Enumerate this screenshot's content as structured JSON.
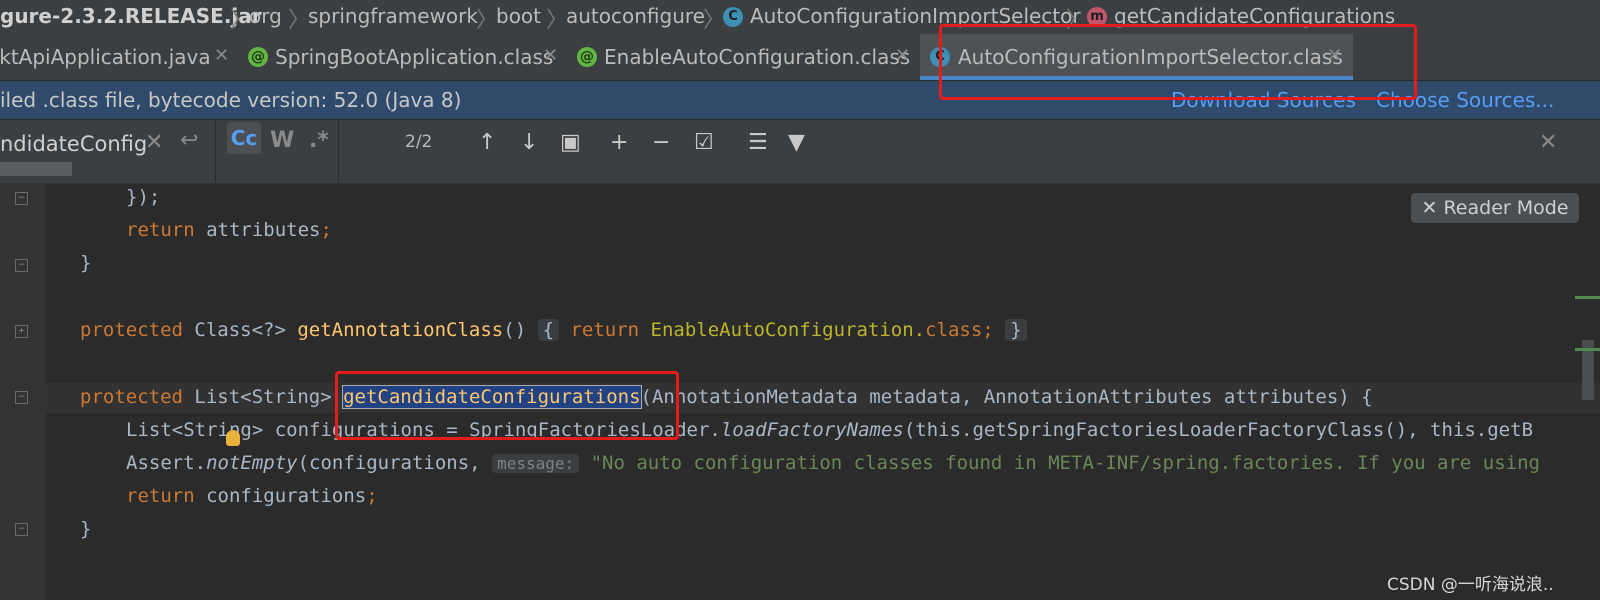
{
  "breadcrumb": {
    "jar": "gure-2.3.2.RELEASE.jar",
    "items": [
      "org",
      "springframework",
      "boot",
      "autoconfigure"
    ],
    "class_icon": "C",
    "class_name": "AutoConfigurationImportSelector",
    "method_icon": "m",
    "method_name": "getCandidateConfigurations"
  },
  "tabs": [
    {
      "label": "MktApiApplication.java",
      "icon": "none"
    },
    {
      "label": "SpringBootApplication.class",
      "icon": "@"
    },
    {
      "label": "EnableAutoConfiguration.class",
      "icon": "@"
    },
    {
      "label": "AutoConfigurationImportSelector.class",
      "icon": "C",
      "active": true
    }
  ],
  "banner": {
    "message": "iled .class file, bytecode version: 52.0 (Java 8)",
    "download_sources": "Download Sources",
    "choose_sources": "Choose Sources..."
  },
  "find": {
    "query": "ndidateConfig",
    "match_case": "Cc",
    "words": "W",
    "regex": ".*",
    "count": "2/2"
  },
  "reader_mode": "Reader Mode",
  "code": {
    "l1": "});",
    "l2_kw": "return",
    "l2_rest": " attributes",
    "l3": "}",
    "l4_kw": "protected",
    "l4_type": " Class<?> ",
    "l4_fn": "getAnnotationClass",
    "l4_paren": "() ",
    "l4_brace_open": "{",
    "l4_ret": " return ",
    "l4_cls": "EnableAutoConfiguration.",
    "l4_class_kw": "class",
    "l4_semi": "; ",
    "l4_brace_close": "}",
    "l5_kw": "protected",
    "l5_type": " List<String> ",
    "l5_fn": "getCandidateConfigurations",
    "l5_params": "(AnnotationMetadata metadata, AnnotationAttributes attributes) {",
    "l6_a": "List<String> configurations = SpringFactoriesLoader.",
    "l6_call": "loadFactoryNames",
    "l6_b": "(this.getSpringFactoriesLoaderFactoryClass(), this.getB",
    "l7_a": "Assert.",
    "l7_call": "notEmpty",
    "l7_b": "(configurations, ",
    "l7_hint": "message:",
    "l7_str": " \"No auto configuration classes found in META-INF/spring.factories. If you are using",
    "l8_kw": "return",
    "l8_rest": " configurations",
    "l9": "}"
  },
  "watermark": "CSDN @一听海说浪.."
}
